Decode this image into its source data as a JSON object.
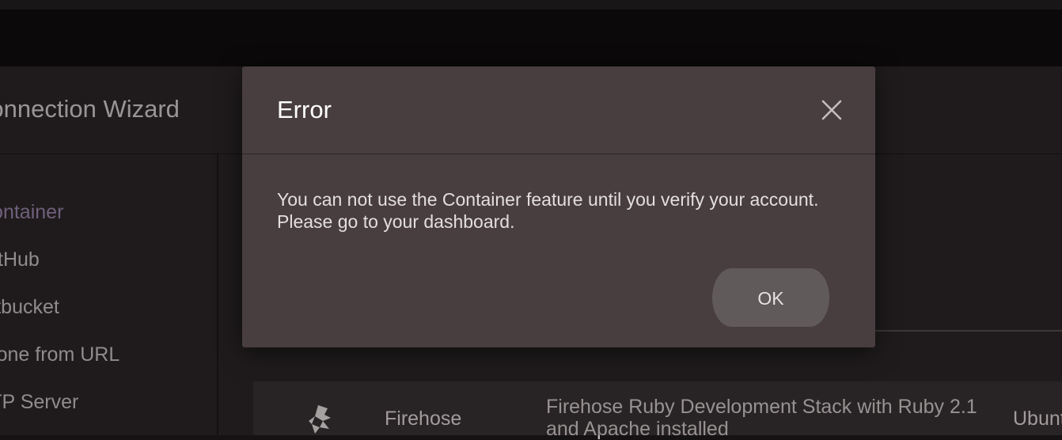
{
  "wizard": {
    "title": "Connection Wizard"
  },
  "sidebar": {
    "items": [
      {
        "label": "Container",
        "active": true
      },
      {
        "label": "GitHub"
      },
      {
        "label": "Bitbucket"
      },
      {
        "label": "Clone from URL"
      },
      {
        "label": "FTP Server"
      }
    ]
  },
  "stack_row": {
    "name": "Firehose",
    "description": "Firehose Ruby Development Stack with Ruby 2.1 and Apache installed",
    "os": "Ubuntu",
    "icon": "firehose-logo-icon"
  },
  "modal": {
    "title": "Error",
    "message_line1": "You can not use the Container feature until you verify your account.",
    "message_line2": "Please go to your dashboard.",
    "ok_label": "OK",
    "close_icon": "close-icon"
  },
  "colors": {
    "modal_bg": "#483e3f",
    "accent_active": "#8f7ea3",
    "page_bg": "#262223"
  }
}
